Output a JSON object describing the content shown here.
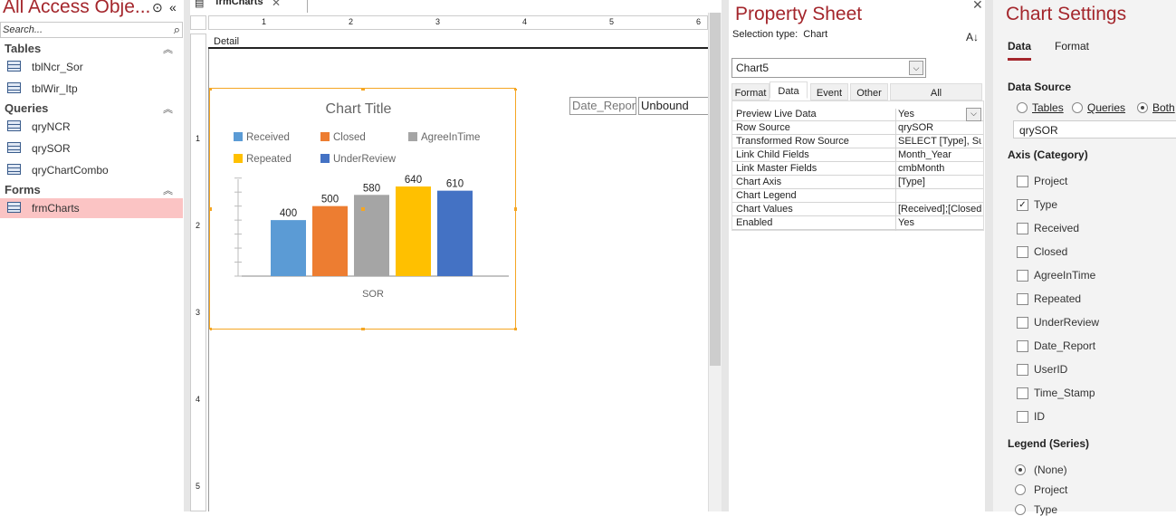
{
  "nav": {
    "title": "All Access Obje...",
    "search_placeholder": "Search...",
    "groups": [
      {
        "label": "Tables",
        "items": [
          "tblNcr_Sor",
          "tblWir_Itp"
        ]
      },
      {
        "label": "Queries",
        "items": [
          "qryNCR",
          "qrySOR",
          "qryChartCombo"
        ]
      },
      {
        "label": "Forms",
        "items": [
          "frmCharts"
        ]
      }
    ]
  },
  "designer": {
    "tab": "frmCharts",
    "section": "Detail",
    "ruler_h": [
      "1",
      "2",
      "3",
      "4",
      "5",
      "6"
    ],
    "ruler_v": [
      "1",
      "2",
      "3",
      "4",
      "5"
    ],
    "date_label": "Date_Repor",
    "unbound": "Unbound"
  },
  "chart_data": {
    "type": "bar",
    "title": "Chart Title",
    "xlabel": "SOR",
    "categories": [
      "SOR"
    ],
    "series": [
      {
        "name": "Received",
        "values": [
          400
        ],
        "color": "#5b9bd5"
      },
      {
        "name": "Closed",
        "values": [
          500
        ],
        "color": "#ed7d31"
      },
      {
        "name": "AgreeInTime",
        "values": [
          580
        ],
        "color": "#a5a5a5"
      },
      {
        "name": "Repeated",
        "values": [
          640
        ],
        "color": "#ffc000"
      },
      {
        "name": "UnderReview",
        "values": [
          610
        ],
        "color": "#4472c4"
      }
    ],
    "ylim": [
      0,
      700
    ]
  },
  "property_sheet": {
    "title": "Property Sheet",
    "selection_label": "Selection type:",
    "selection_type": "Chart",
    "object": "Chart5",
    "tabs": [
      "Format",
      "Data",
      "Event",
      "Other",
      "All"
    ],
    "active_tab": "Data",
    "rows": [
      {
        "k": "Preview Live Data",
        "v": "Yes"
      },
      {
        "k": "Row Source",
        "v": "qrySOR"
      },
      {
        "k": "Transformed Row Source",
        "v": "SELECT [Type], Sum"
      },
      {
        "k": "Link Child Fields",
        "v": "Month_Year"
      },
      {
        "k": "Link Master Fields",
        "v": "cmbMonth"
      },
      {
        "k": "Chart Axis",
        "v": "[Type]"
      },
      {
        "k": "Chart Legend",
        "v": ""
      },
      {
        "k": "Chart Values",
        "v": "[Received];[Closed]"
      },
      {
        "k": "Enabled",
        "v": "Yes"
      }
    ]
  },
  "chart_settings": {
    "title": "Chart Settings",
    "tabs": [
      "Data",
      "Format"
    ],
    "data_source_label": "Data Source",
    "sources": [
      "Tables",
      "Queries",
      "Both"
    ],
    "source_value": "qrySOR",
    "axis_label": "Axis (Category)",
    "axis_fields": [
      {
        "n": "Project",
        "c": false
      },
      {
        "n": "Type",
        "c": true
      },
      {
        "n": "Received",
        "c": false
      },
      {
        "n": "Closed",
        "c": false
      },
      {
        "n": "AgreeInTime",
        "c": false
      },
      {
        "n": "Repeated",
        "c": false
      },
      {
        "n": "UnderReview",
        "c": false
      },
      {
        "n": "Date_Report",
        "c": false
      },
      {
        "n": "UserID",
        "c": false
      },
      {
        "n": "Time_Stamp",
        "c": false
      },
      {
        "n": "ID",
        "c": false
      }
    ],
    "legend_label": "Legend (Series)",
    "legend_options": [
      "(None)",
      "Project",
      "Type"
    ]
  }
}
